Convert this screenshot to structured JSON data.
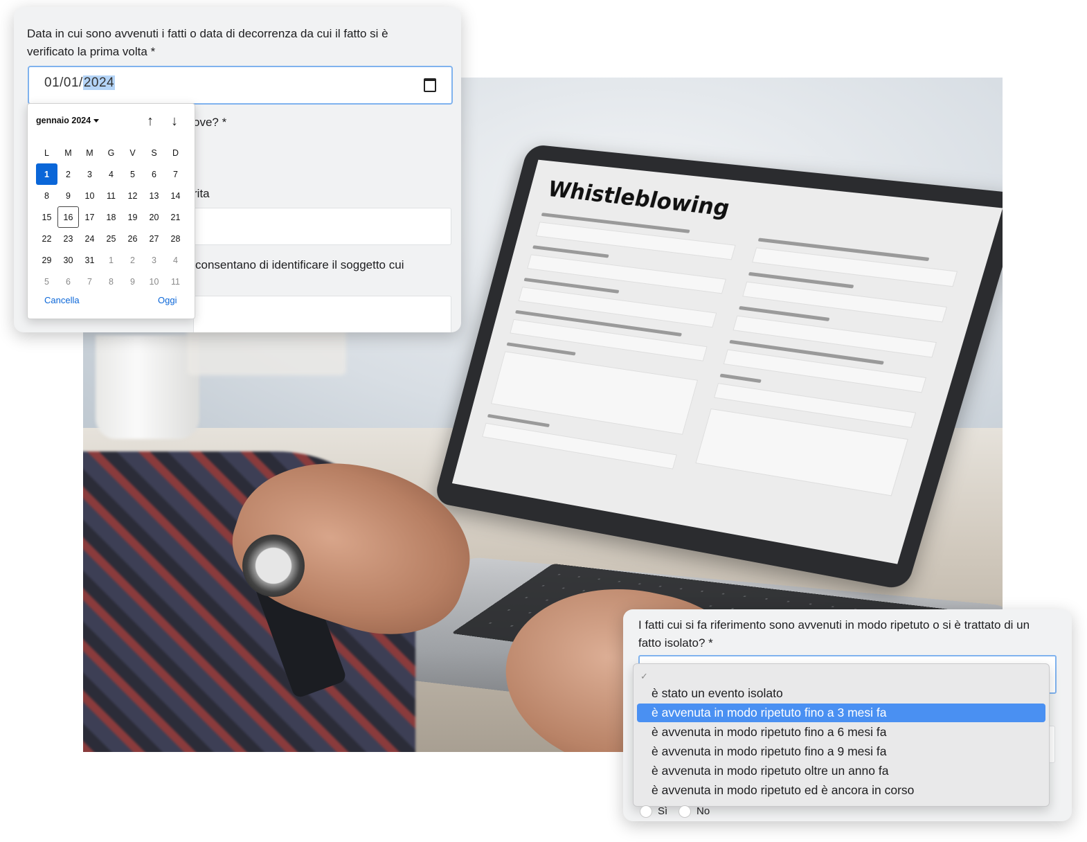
{
  "screen_title": "Whistleblowing",
  "date_question": {
    "label": "Data in cui sono avvenuti i fatti o data di decorrenza da cui il fatto si è verificato la prima volta *",
    "value_prefix": "01/01/",
    "value_selected": "2024"
  },
  "background_form": {
    "q_prove_suffix": "ove? *",
    "q_reperita_suffix": "rita",
    "q_identificare_part": "consentano di identificare il soggetto cui"
  },
  "calendar": {
    "month_label": "gennaio 2024",
    "prev_arrow": "↑",
    "next_arrow": "↓",
    "weekdays": [
      "L",
      "M",
      "M",
      "G",
      "V",
      "S",
      "D"
    ],
    "weeks": [
      [
        "1",
        "2",
        "3",
        "4",
        "5",
        "6",
        "7"
      ],
      [
        "8",
        "9",
        "10",
        "11",
        "12",
        "13",
        "14"
      ],
      [
        "15",
        "16",
        "17",
        "18",
        "19",
        "20",
        "21"
      ],
      [
        "22",
        "23",
        "24",
        "25",
        "26",
        "27",
        "28"
      ],
      [
        "29",
        "30",
        "31",
        "1",
        "2",
        "3",
        "4"
      ],
      [
        "5",
        "6",
        "7",
        "8",
        "9",
        "10",
        "11"
      ]
    ],
    "cancel_label": "Cancella",
    "today_label": "Oggi"
  },
  "repeat_question": {
    "label": "I fatti cui si fa riferimento sono avvenuti in modo ripetuto o si è trattato di un fatto isolato? *",
    "checkmark": "✓",
    "options": [
      "è stato un evento isolato",
      "è avvenuta in modo ripetuto fino a 3 mesi fa",
      "è avvenuta in modo ripetuto fino a 6 mesi fa",
      "è avvenuta in modo ripetuto fino a 9 mesi fa",
      "è avvenuta in modo ripetuto oltre un anno fa",
      "è avvenuta in modo ripetuto ed è ancora in corso"
    ],
    "highlighted_index": 1,
    "radio_yes": "Sì",
    "radio_no": "No"
  },
  "colors": {
    "accent": "#0a66d8",
    "highlight": "#4a90f2",
    "focus_border": "#7fb2ee"
  }
}
